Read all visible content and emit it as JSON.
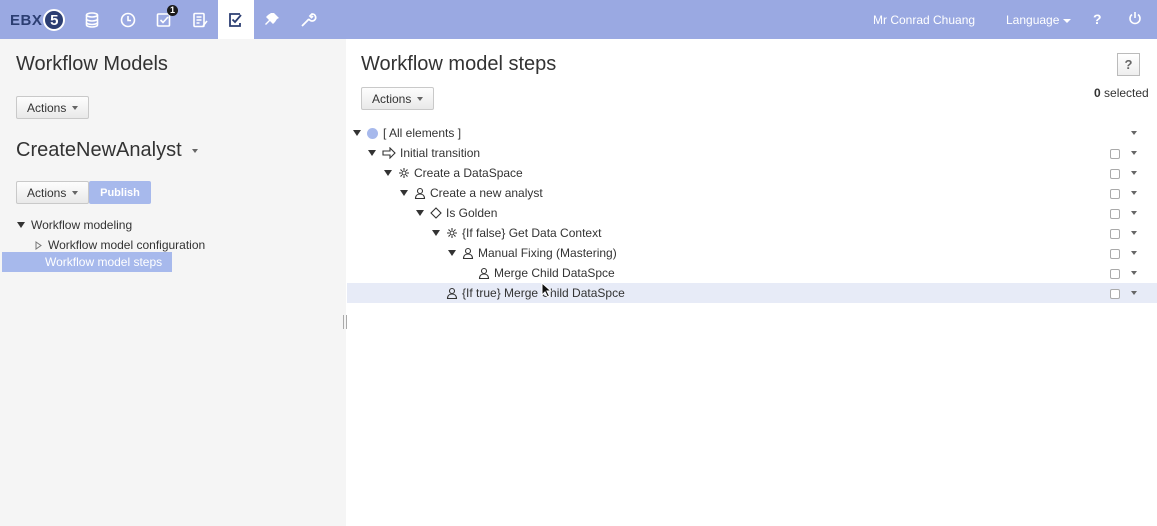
{
  "topbar": {
    "logo_text": "EBX",
    "logo_num": "5",
    "notification_count": "1",
    "user": "Mr Conrad Chuang",
    "language_label": "Language",
    "help_label": "?",
    "nav_icons": [
      "database-icon",
      "clock-icon",
      "tasks-icon",
      "document-edit-icon",
      "workflow-check-icon",
      "plugin-icon",
      "wrench-icon"
    ],
    "colors": {
      "bar": "#9aa9e2",
      "accent": "#a7b9ec",
      "logo": "#2c3e72"
    }
  },
  "left": {
    "title": "Workflow Models",
    "actions_label": "Actions",
    "model_name": "CreateNewAnalyst",
    "model_actions_label": "Actions",
    "publish_label": "Publish",
    "tree": {
      "root": "Workflow modeling",
      "child_config": "Workflow model configuration",
      "child_steps": "Workflow model steps"
    }
  },
  "right": {
    "title": "Workflow model steps",
    "help_label": "?",
    "actions_label": "Actions",
    "selected_count": "0",
    "selected_suffix": "selected",
    "rows": [
      {
        "label": "[ All elements ]",
        "icon": "circle-icon"
      },
      {
        "label": "Initial transition",
        "icon": "transition-arrow-icon"
      },
      {
        "label": "Create a DataSpace",
        "icon": "gear-icon"
      },
      {
        "label": "Create a new analyst",
        "icon": "user-task-icon"
      },
      {
        "label": "Is Golden",
        "icon": "diamond-condition-icon"
      },
      {
        "label": "{If false} Get Data Context",
        "icon": "gear-icon"
      },
      {
        "label": "Manual Fixing (Mastering)",
        "icon": "user-task-icon"
      },
      {
        "label": "Merge Child DataSpce",
        "icon": "user-task-icon"
      },
      {
        "label": "{If true} Merge Child DataSpce",
        "icon": "user-task-icon"
      }
    ]
  }
}
